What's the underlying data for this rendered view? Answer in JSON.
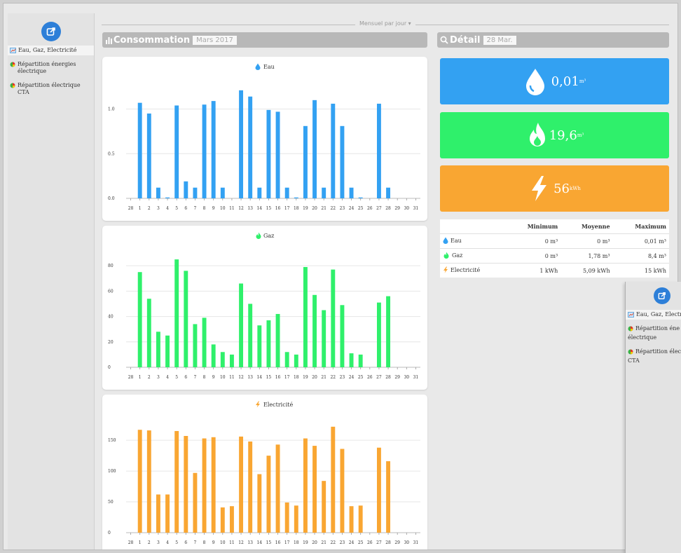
{
  "sidebar": {
    "items": [
      {
        "label": "Eau, Gaz, Electricité",
        "icon": "grid-chart-icon"
      },
      {
        "label": "Répartition énergies électrique",
        "icon": "pie-chart-icon"
      },
      {
        "label": "Répartition électrique CTA",
        "icon": "pie-chart-icon"
      }
    ]
  },
  "popup": {
    "items": [
      {
        "label": "Eau, Gaz, Electric"
      },
      {
        "label": "Répartition éne"
      },
      {
        "label": "électrique"
      },
      {
        "label": "Répartition élec"
      },
      {
        "label": "CTA"
      }
    ]
  },
  "period_selector": {
    "label": "Mensuel par jour ▾"
  },
  "consumption": {
    "title": "Consommation",
    "period": "Mars 2017"
  },
  "detail": {
    "title": "Détail",
    "date": "28 Mar.",
    "tiles": [
      {
        "name": "eau",
        "value": "0,01",
        "unit": "m³",
        "color": "#33a1f2"
      },
      {
        "name": "gaz",
        "value": "19,6",
        "unit": "m³",
        "color": "#2ff06b"
      },
      {
        "name": "electricite",
        "value": "56",
        "unit": "kWh",
        "color": "#f9a632"
      }
    ],
    "table": {
      "headers": [
        "Minimum",
        "Moyenne",
        "Maximum"
      ],
      "rows": [
        {
          "label": "Eau",
          "min": "0 m³",
          "avg": "0 m³",
          "max": "0,01 m³"
        },
        {
          "label": "Gaz",
          "min": "0 m³",
          "avg": "1,78 m³",
          "max": "8,4 m³"
        },
        {
          "label": "Electricité",
          "min": "1 kWh",
          "avg": "5,09 kWh",
          "max": "15 kWh"
        }
      ]
    }
  },
  "chart_data": [
    {
      "type": "bar",
      "title": "Eau",
      "color": "#33a1f2",
      "categories": [
        "28",
        "1",
        "2",
        "3",
        "4",
        "5",
        "6",
        "7",
        "8",
        "9",
        "10",
        "11",
        "12",
        "13",
        "14",
        "15",
        "16",
        "17",
        "18",
        "19",
        "20",
        "21",
        "22",
        "23",
        "24",
        "25",
        "26",
        "27",
        "28",
        "29",
        "30",
        "31"
      ],
      "values": [
        0,
        1.07,
        0.95,
        0.12,
        0.01,
        1.04,
        0.19,
        0.12,
        1.05,
        1.09,
        0.12,
        0,
        1.21,
        1.14,
        0.12,
        0.99,
        0.97,
        0.12,
        0.01,
        0.81,
        1.1,
        0.12,
        1.06,
        0.81,
        0.12,
        0.01,
        0,
        1.06,
        0.12,
        0,
        0,
        0
      ],
      "yticks": [
        "0.0",
        "0.5",
        "1.0"
      ],
      "ylim": [
        0,
        1.35
      ]
    },
    {
      "type": "bar",
      "title": "Gaz",
      "color": "#2ff06b",
      "categories": [
        "28",
        "1",
        "2",
        "3",
        "4",
        "5",
        "6",
        "7",
        "8",
        "9",
        "10",
        "11",
        "12",
        "13",
        "14",
        "15",
        "16",
        "17",
        "18",
        "19",
        "20",
        "21",
        "22",
        "23",
        "24",
        "25",
        "26",
        "27",
        "28",
        "29",
        "30",
        "31"
      ],
      "values": [
        0,
        75,
        54,
        28,
        25,
        85,
        76,
        34,
        39,
        18,
        12,
        10,
        66,
        50,
        33,
        37,
        42,
        12,
        10,
        79,
        57,
        45,
        77,
        49,
        11,
        10,
        0,
        51,
        56,
        0,
        0,
        0
      ],
      "yticks": [
        "0",
        "20",
        "40",
        "60",
        "80"
      ],
      "ylim": [
        0,
        95
      ]
    },
    {
      "type": "bar",
      "title": "Electricité",
      "color": "#f9a632",
      "categories": [
        "28",
        "1",
        "2",
        "3",
        "4",
        "5",
        "6",
        "7",
        "8",
        "9",
        "10",
        "11",
        "12",
        "13",
        "14",
        "15",
        "16",
        "17",
        "18",
        "19",
        "20",
        "21",
        "22",
        "23",
        "24",
        "25",
        "26",
        "27",
        "28",
        "29",
        "30",
        "31"
      ],
      "values": [
        0,
        167,
        166,
        62,
        62,
        165,
        157,
        97,
        153,
        155,
        41,
        43,
        156,
        148,
        95,
        125,
        143,
        49,
        44,
        153,
        141,
        84,
        172,
        136,
        43,
        44,
        0,
        138,
        116,
        0,
        0,
        0
      ],
      "yticks": [
        "0",
        "50",
        "100",
        "150"
      ],
      "ylim": [
        0,
        190
      ]
    }
  ]
}
